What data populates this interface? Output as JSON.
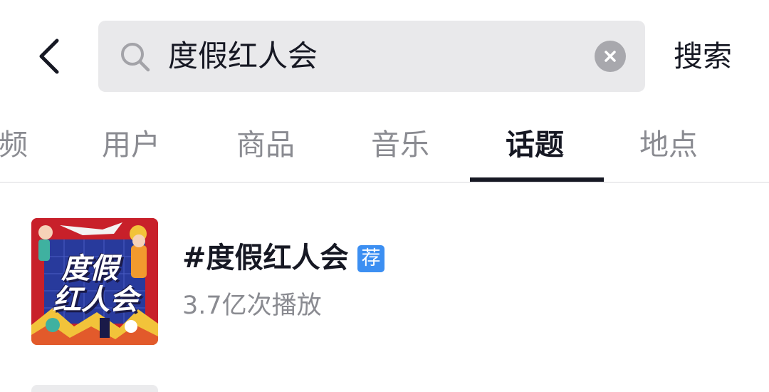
{
  "header": {
    "back_icon": "chevron-left-icon",
    "search": {
      "icon": "search-icon",
      "value": "度假红人会",
      "clear_icon": "clear-circle-icon"
    },
    "search_button_label": "搜索"
  },
  "tabs": {
    "items": [
      {
        "label": "频",
        "active": false
      },
      {
        "label": "用户",
        "active": false
      },
      {
        "label": "商品",
        "active": false
      },
      {
        "label": "音乐",
        "active": false
      },
      {
        "label": "话题",
        "active": true
      },
      {
        "label": "地点",
        "active": false
      }
    ]
  },
  "results": [
    {
      "cover_lines": [
        "度假",
        "红人会"
      ],
      "title": "#度假红人会",
      "badge": "荐",
      "meta": "3.7亿次播放"
    }
  ],
  "colors": {
    "search_bg": "#e9e9eb",
    "text_primary": "#161823",
    "text_secondary": "#8a8b91",
    "badge_blue": "#3c8ff2",
    "cover_red": "#c8202a"
  }
}
